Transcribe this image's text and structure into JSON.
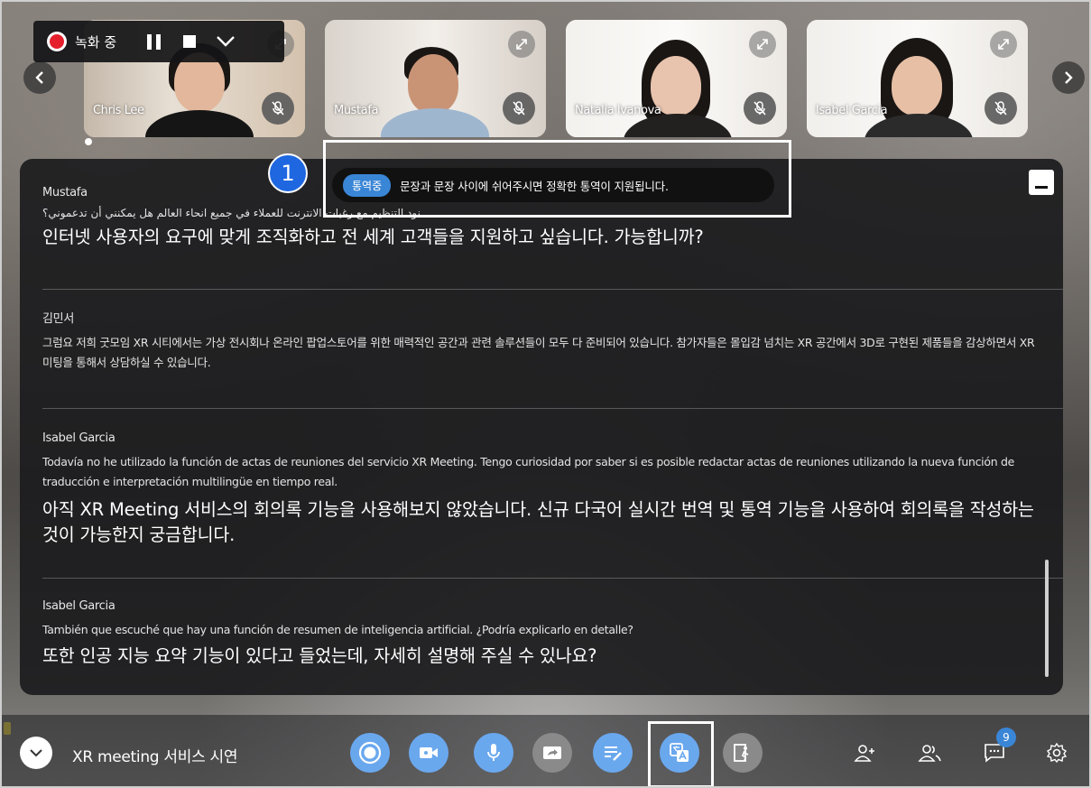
{
  "recording": {
    "label": "녹화 중"
  },
  "participants": [
    {
      "name": "Chris Lee"
    },
    {
      "name": "Mustafa"
    },
    {
      "name": "Natalia Ivanova"
    },
    {
      "name": "Isabel Garcia"
    }
  ],
  "notice": {
    "callout_number": "1",
    "badge": "통역중",
    "text": "문장과 문장 사이에 쉬어주시면 정확한 통역이 지원됩니다."
  },
  "transcript": [
    {
      "speaker": "Mustafa",
      "original": "نود التنظيم مع رغبات الانترنت للعملاء في جميع انحاء العالم هل يمكنني أن تدعموني؟",
      "translated": "인터넷 사용자의 요구에 맞게 조직화하고 전 세계 고객들을 지원하고 싶습니다. 가능합니까?"
    },
    {
      "speaker": "김민서",
      "original": "그럼요 저희 굿모임 XR 시티에서는 가상 전시회나 온라인 팝업스토어를 위한 매력적인 공간과 관련 솔루션들이 모두 다 준비되어 있습니다. 참가자들은 몰입감 넘치는 XR 공간에서 3D로 구현된 제품들을 감상하면서 XR 미팅을 통해서 상담하실 수 있습니다.",
      "translated": ""
    },
    {
      "speaker": "Isabel Garcia",
      "original": "Todavía no he utilizado la función de actas de reuniones del servicio XR Meeting. Tengo curiosidad por saber si es posible redactar actas de reuniones utilizando la nueva función de traducción e interpretación multilingüe en tiempo real.",
      "translated": "아직 XR Meeting 서비스의 회의록 기능을 사용해보지 않았습니다. 신규 다국어 실시간 번역 및 통역 기능을 사용하여 회의록을 작성하는 것이 가능한지 궁금합니다."
    },
    {
      "speaker": "Isabel Garcia",
      "original": "También que escuché que hay una función de resumen de inteligencia artificial. ¿Podría explicarlo en detalle?",
      "translated": "또한 인공 지능 요약 기능이 있다고 들었는데, 자세히 설명해 주실 수 있나요?"
    }
  ],
  "bottom_bar": {
    "meeting_title": "XR meeting 서비스 시연",
    "chat_badge": "9"
  },
  "colors": {
    "accent_blue": "#6aa8ee",
    "badge_blue": "#3a86d6",
    "record_red": "#e5202c",
    "callout_blue": "#1f67e0"
  },
  "icons": [
    "record-icon",
    "pause-icon",
    "stop-icon",
    "chevron-down-icon",
    "expand-icon",
    "mic-off-icon",
    "chevron-left-icon",
    "chevron-right-icon",
    "minimize-icon",
    "camera-icon",
    "mic-icon",
    "screen-share-icon",
    "memo-icon",
    "translate-icon",
    "exit-icon",
    "invite-icon",
    "participants-icon",
    "chat-icon",
    "settings-icon"
  ]
}
